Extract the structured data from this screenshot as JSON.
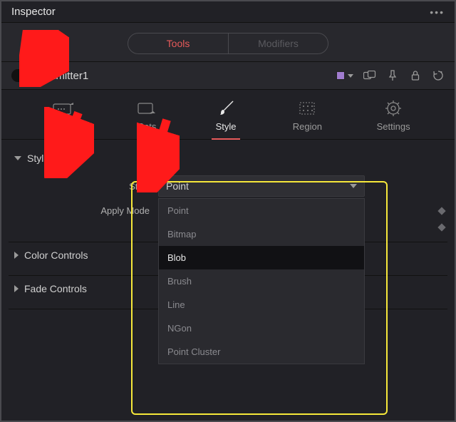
{
  "panel": {
    "title": "Inspector"
  },
  "topTabs": {
    "tools": "Tools",
    "modifiers": "Modifiers"
  },
  "node": {
    "name": "pEmitter1"
  },
  "subTabs": {
    "controls": "Controls",
    "sets": "Sets",
    "style": "Style",
    "region": "Region",
    "settings": "Settings"
  },
  "sections": {
    "style": "Style",
    "colorControls": "Color Controls",
    "fadeControls": "Fade Controls"
  },
  "fields": {
    "style": {
      "label": "Style",
      "value": "Point"
    },
    "applyMode": {
      "label": "Apply Mode"
    }
  },
  "styleOptions": [
    "Point",
    "Bitmap",
    "Blob",
    "Brush",
    "Line",
    "NGon",
    "Point Cluster"
  ],
  "styleHoverIndex": 2
}
